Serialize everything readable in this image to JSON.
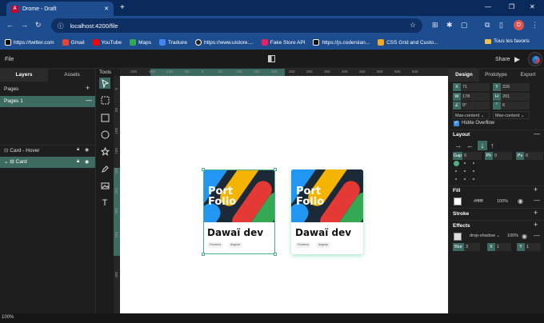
{
  "browser": {
    "tab_title": "Drome - Draft",
    "url": "localhost:4200/file",
    "profile_initial": "D",
    "bookmarks": [
      {
        "label": "https://twitter.com",
        "color": "#000000"
      },
      {
        "label": "Gmail",
        "color": "#ea4335"
      },
      {
        "label": "YouTube",
        "color": "#ff0000"
      },
      {
        "label": "Maps",
        "color": "#34a853"
      },
      {
        "label": "Traduire",
        "color": "#4285f4"
      },
      {
        "label": "https://www.uistore....",
        "color": "#222222"
      },
      {
        "label": "Fake Store API",
        "color": "#e91e63"
      },
      {
        "label": "https://js.coderslan...",
        "color": "#111111"
      },
      {
        "label": "CSS Grid and Custo...",
        "color": "#f5a623"
      }
    ],
    "all_bookmarks": "Tous les favoris"
  },
  "app": {
    "menu_file": "File",
    "share": "Share",
    "zoom": "100%"
  },
  "left_panel": {
    "tabs": [
      "Layers",
      "Assets"
    ],
    "pages_label": "Pages",
    "pages": [
      "Pages 1"
    ],
    "layers": [
      "Card - Hover",
      "Card"
    ],
    "tools_label": "Tools"
  },
  "tools": [
    "select-icon",
    "frame-icon",
    "rectangle-icon",
    "ellipse-icon",
    "star-icon",
    "pen-icon",
    "image-icon",
    "text-icon"
  ],
  "ruler": {
    "top": [
      "-200",
      "-150",
      "-100",
      "-50",
      "0",
      "50",
      "100",
      "150",
      "200",
      "250",
      "300",
      "350",
      "400",
      "450",
      "500",
      "550",
      "600"
    ],
    "left": [
      "0",
      "50",
      "100",
      "150",
      "200",
      "250",
      "300",
      "350",
      "400"
    ]
  },
  "cards": [
    {
      "image_text_1": "Port",
      "image_text_2": "Folio",
      "title": "Dawaï dev",
      "chips": [
        "Frontend",
        "Angular"
      ]
    },
    {
      "image_text_1": "Port",
      "image_text_2": "Folio",
      "title": "Dawaï dev",
      "chips": [
        "Frontend",
        "Angular"
      ]
    }
  ],
  "right_panel": {
    "tabs": [
      "Design",
      "Prototype",
      "Export"
    ],
    "x": "71",
    "y": "226",
    "w": "178",
    "h": "201",
    "rotation": "0°",
    "radius": "6",
    "width_mode": "Max-content",
    "height_mode": "Max-content",
    "hide_overflow": "Hidde Overflow",
    "layout_label": "Layout",
    "gap": "0",
    "padding_h": "0",
    "padding_v": "0",
    "fill_label": "Fill",
    "fill_hex": "#ffffff",
    "fill_opacity": "100%",
    "stroke_label": "Stroke",
    "effects_label": "Effects",
    "effect_type": "drop-shadow",
    "effect_opacity": "100%",
    "blur": "3",
    "ex": "1",
    "ey": "1",
    "labels": {
      "x": "X",
      "y": "Y",
      "w": "W",
      "h": "H",
      "gap": "Gap",
      "ph": "Ph",
      "pv": "Pv",
      "blur": "Blur"
    }
  },
  "colors": {
    "accent": "#3d6b5f",
    "brand_blue": "#1d4d8f",
    "canvas": "#ffffff"
  }
}
